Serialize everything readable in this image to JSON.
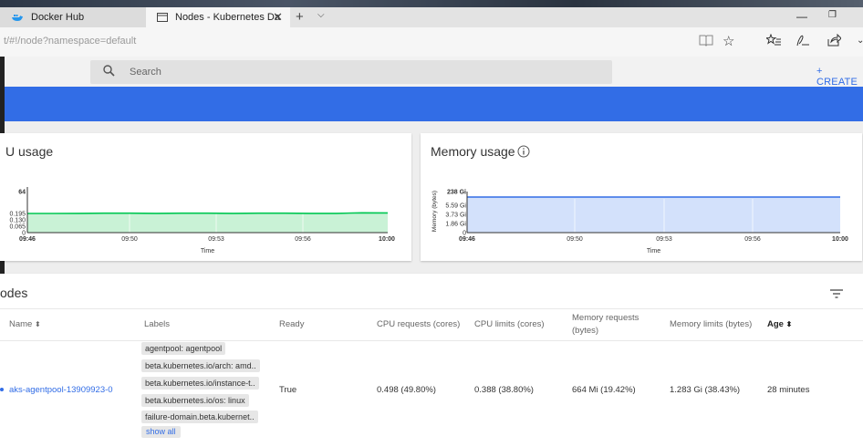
{
  "browser": {
    "tabs": [
      {
        "title": "Docker Hub"
      },
      {
        "title": "Nodes - Kubernetes Da"
      }
    ],
    "url": "t/#!/node?namespace=default"
  },
  "header": {
    "search_placeholder": "Search",
    "create_label": "+ CREATE"
  },
  "cpu_card": {
    "title": "U usage"
  },
  "mem_card": {
    "title": "Memory usage"
  },
  "chart_data": [
    {
      "type": "area",
      "title": "U usage",
      "xlabel": "Time",
      "ylabel": "",
      "x_ticks": [
        "09:46",
        "09:50",
        "09:53",
        "09:56",
        "10:00"
      ],
      "y_ticks": [
        "0",
        "0.065",
        "0.130",
        "0.195",
        "64"
      ],
      "color": "#00c752",
      "fill": "#c9f2d6",
      "series": [
        {
          "values": [
            0.195,
            0.195,
            0.196,
            0.197,
            0.197,
            0.196,
            0.197,
            0.197,
            0.196,
            0.197,
            0.197,
            0.196,
            0.196,
            0.2,
            0.199
          ]
        }
      ]
    },
    {
      "type": "area",
      "title": "Memory usage",
      "xlabel": "Time",
      "ylabel": "Memory (bytes)",
      "x_ticks": [
        "09:46",
        "09:50",
        "09:53",
        "09:56",
        "10:00"
      ],
      "y_ticks": [
        "0",
        "1.86 Gi",
        "3.73 Gi",
        "5.59 Gi",
        "238 Gi"
      ],
      "color": "#326de6",
      "fill": "#d3e1fb",
      "series": [
        {
          "values": [
            238,
            238,
            238,
            238,
            238,
            238,
            238,
            238,
            238,
            238,
            238,
            238,
            238,
            238,
            238
          ]
        }
      ]
    }
  ],
  "nodes": {
    "title": "odes",
    "columns": {
      "name": "Name",
      "labels": "Labels",
      "ready": "Ready",
      "cpu_req": "CPU requests (cores)",
      "cpu_lim": "CPU limits (cores)",
      "mem_req_1": "Memory requests",
      "mem_req_2": "(bytes)",
      "mem_lim": "Memory limits (bytes)",
      "age": "Age"
    },
    "rows": [
      {
        "name": "aks-agentpool-13909923-0",
        "labels": [
          "agentpool: agentpool",
          "beta.kubernetes.io/arch: amd..",
          "beta.kubernetes.io/instance-t..",
          "beta.kubernetes.io/os: linux",
          "failure-domain.beta.kubernet.."
        ],
        "show_all": "show all",
        "ready": "True",
        "cpu_req": "0.498 (49.80%)",
        "cpu_lim": "0.388 (38.80%)",
        "mem_req": "664 Mi (19.42%)",
        "mem_lim": "1.283 Gi (38.43%)",
        "age": "28 minutes"
      }
    ]
  }
}
